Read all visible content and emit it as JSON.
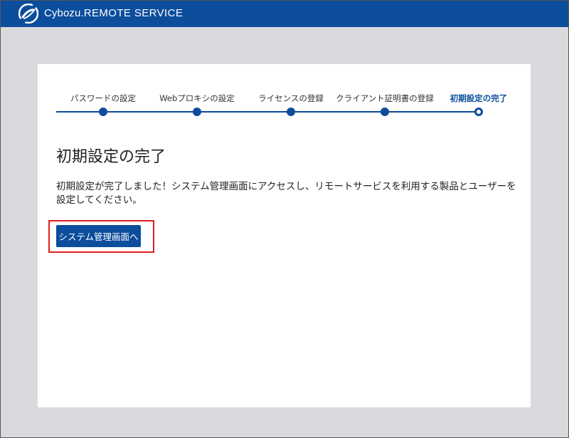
{
  "header": {
    "brand_prefix": "Cybozu.",
    "brand_suffix": "REMOTE SERVICE"
  },
  "steps": [
    {
      "label": "パスワードの設定",
      "state": "done"
    },
    {
      "label": "Webプロキシの設定",
      "state": "done"
    },
    {
      "label": "ライセンスの登録",
      "state": "done"
    },
    {
      "label": "クライアント証明書の登録",
      "state": "done"
    },
    {
      "label": "初期設定の完了",
      "state": "current"
    }
  ],
  "main": {
    "title": "初期設定の完了",
    "message": "初期設定が完了しました！システム管理画面にアクセスし、リモートサービスを利用する製品とユーザーを設定してください。",
    "button_label": "システム管理画面へ"
  },
  "colors": {
    "brand_blue": "#0c4d9c",
    "highlight_red": "#e01e1e",
    "background": "#d9dadd"
  }
}
